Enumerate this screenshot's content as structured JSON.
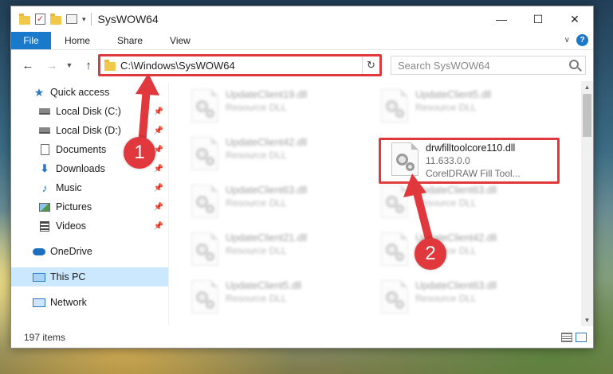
{
  "window": {
    "title": "SysWOW64",
    "controls": {
      "minimize": "—",
      "maximize": "☐",
      "close": "✕"
    }
  },
  "ribbon": {
    "tabs": [
      "File",
      "Home",
      "Share",
      "View"
    ]
  },
  "address_bar": {
    "path": "C:\\Windows\\SysWOW64",
    "search_placeholder": "Search SysWOW64"
  },
  "sidebar": {
    "items": [
      {
        "label": "Quick access",
        "icon": "star-icon"
      },
      {
        "label": "Local Disk (C:)",
        "icon": "disk-icon",
        "pinned": true
      },
      {
        "label": "Local Disk (D:)",
        "icon": "disk-icon",
        "pinned": true
      },
      {
        "label": "Documents",
        "icon": "documents-icon",
        "pinned": true
      },
      {
        "label": "Downloads",
        "icon": "downloads-icon",
        "pinned": true
      },
      {
        "label": "Music",
        "icon": "music-icon",
        "pinned": true
      },
      {
        "label": "Pictures",
        "icon": "pictures-icon",
        "pinned": true
      },
      {
        "label": "Videos",
        "icon": "videos-icon",
        "pinned": true
      },
      {
        "label": "OneDrive",
        "icon": "onedrive-icon"
      },
      {
        "label": "This PC",
        "icon": "this-pc-icon",
        "selected": true
      },
      {
        "label": "Network",
        "icon": "network-icon"
      }
    ]
  },
  "files": {
    "left_column": [
      {
        "name": "UpdateClient19.dll",
        "type": "Resource DLL"
      },
      {
        "name": "UpdateClient42.dll",
        "type": "Resource DLL"
      },
      {
        "name": "UpdateClient63.dll",
        "type": "Resource DLL"
      },
      {
        "name": "UpdateClient21.dll",
        "type": "Resource DLL"
      },
      {
        "name": "UpdateClient5.dll",
        "type": "Resource DLL"
      }
    ],
    "right_column": [
      {
        "name": "UpdateClient5.dll",
        "type": "Resource DLL"
      },
      {
        "name": "drwfilltoolcore110.dll",
        "version": "11.633.0.0",
        "description": "CorelDRAW Fill Tool...",
        "highlighted": true
      },
      {
        "name": "UpdateClient63.dll",
        "type": "Resource DLL"
      },
      {
        "name": "UpdateClient42.dll",
        "type": "Resource DLL"
      },
      {
        "name": "UpdateClient63.dll",
        "type": "Resource DLL"
      }
    ]
  },
  "status": {
    "item_count": "197 items"
  },
  "annotations": {
    "step1": "1",
    "step2": "2",
    "color": "#e0383c"
  }
}
